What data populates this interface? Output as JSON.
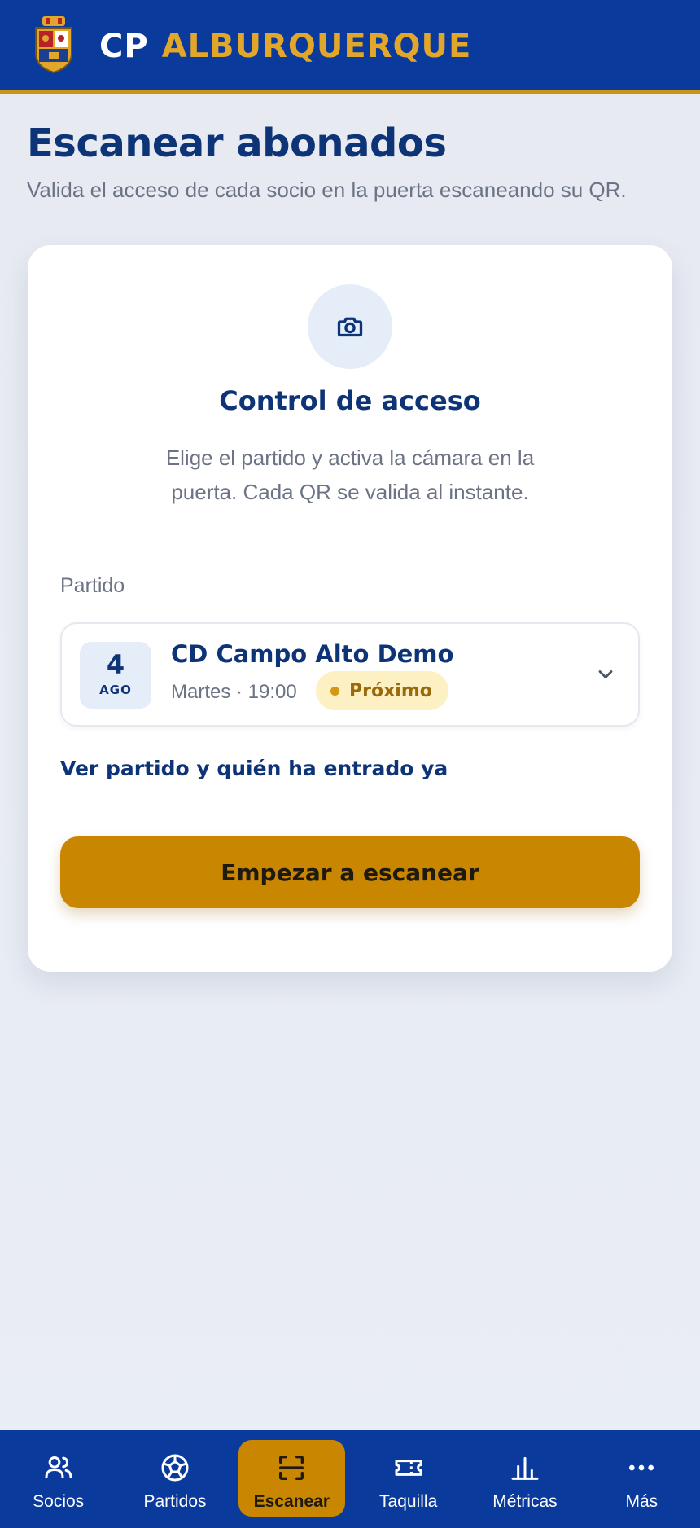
{
  "header": {
    "brand_prefix": "CP",
    "brand_name": "ALBURQUERQUE",
    "crest_icon": "club-crest-icon"
  },
  "page": {
    "title": "Escanear abonados",
    "subtitle": "Valida el acceso de cada socio en la puerta escaneando su QR."
  },
  "card": {
    "icon": "camera-icon",
    "title": "Control de acceso",
    "description": "Elige el partido y activa la cámara en la puerta. Cada QR se valida al instante.",
    "field_label": "Partido",
    "match": {
      "day": "4",
      "month": "AGO",
      "name": "CD Campo Alto Demo",
      "time": "Martes · 19:00",
      "status": "Próximo",
      "status_color": "#fdf1c4"
    },
    "link_label": "Ver partido y quién ha entrado ya",
    "button_label": "Empezar a escanear"
  },
  "nav": {
    "items": [
      {
        "label": "Socios",
        "icon": "users-icon"
      },
      {
        "label": "Partidos",
        "icon": "soccer-ball-icon"
      },
      {
        "label": "Escanear",
        "icon": "scan-icon",
        "active": true
      },
      {
        "label": "Taquilla",
        "icon": "ticket-icon"
      },
      {
        "label": "Métricas",
        "icon": "bar-chart-icon"
      },
      {
        "label": "Más",
        "icon": "more-icon"
      }
    ]
  },
  "colors": {
    "primary": "#0a3a9c",
    "accent": "#c98600",
    "gold": "#e2a72a"
  }
}
